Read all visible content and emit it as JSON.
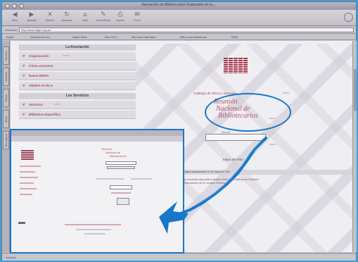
{
  "window": {
    "title": "Asociación de Bibliotecarios Graduados de la ..."
  },
  "toolbar": {
    "buttons": [
      {
        "icon": "back-arrow-icon",
        "label": "Atrás"
      },
      {
        "icon": "forward-arrow-icon",
        "label": "Adelante"
      },
      {
        "icon": "stop-icon",
        "label": "Detener"
      },
      {
        "icon": "refresh-icon",
        "label": "Actualizar"
      },
      {
        "icon": "home-icon",
        "label": "Inicio"
      },
      {
        "icon": "autofill-icon",
        "label": "Autorrellenar"
      },
      {
        "icon": "print-icon",
        "label": "Imprimir"
      },
      {
        "icon": "mail-icon",
        "label": "Correo"
      }
    ]
  },
  "address": {
    "label": "Dirección:",
    "value": "http://www.abgra.org.ar/"
  },
  "favorites": [
    "Apple",
    "Soporte técnico",
    "Apple Store",
    "Mac OS X",
    "Microsoft MacTopia",
    "Office para Macintosh",
    "MSN"
  ],
  "sidetabs": [
    "Favoritos",
    "Historial",
    "Buscar",
    "Álbum",
    "Mis páginas"
  ],
  "sidebar": {
    "section1": "La Asociación",
    "items1": [
      {
        "label": "Organización",
        "new": "nuevo"
      },
      {
        "label": "Cómo asociarse",
        "new": ""
      },
      {
        "label": "Nueva RIOFA",
        "new": ""
      },
      {
        "label": "ABGRA en IFLA",
        "new": ""
      }
    ],
    "section2": "Los Servicios",
    "items2": [
      {
        "label": "Servicios",
        "new": "nuevo"
      },
      {
        "label": "Biblioteca Específica",
        "new": ""
      }
    ]
  },
  "main": {
    "catalogo": "Catálogo de Libros y Servicios",
    "catalogo_new": "nuevo",
    "reunion": [
      "Reunión",
      "Nacional de",
      "Bibliotecarios"
    ],
    "reunion_new": "nuevo",
    "search_label": "Buscar",
    "search_value": "",
    "search_new": "nuevo",
    "mapa": "Mapa del Sitio",
    "update": "Página actualizada el 21 de mayo de 2004",
    "news1": "Se encuentra disponible el Boletín Nacional de Bibliotecas Populares",
    "news2": "Resoluciones de la Comisión Directiva"
  },
  "status": "Internet",
  "colors": {
    "background": "#3a9fdb",
    "accent": "#1877c8",
    "brand": "#a5364c"
  }
}
